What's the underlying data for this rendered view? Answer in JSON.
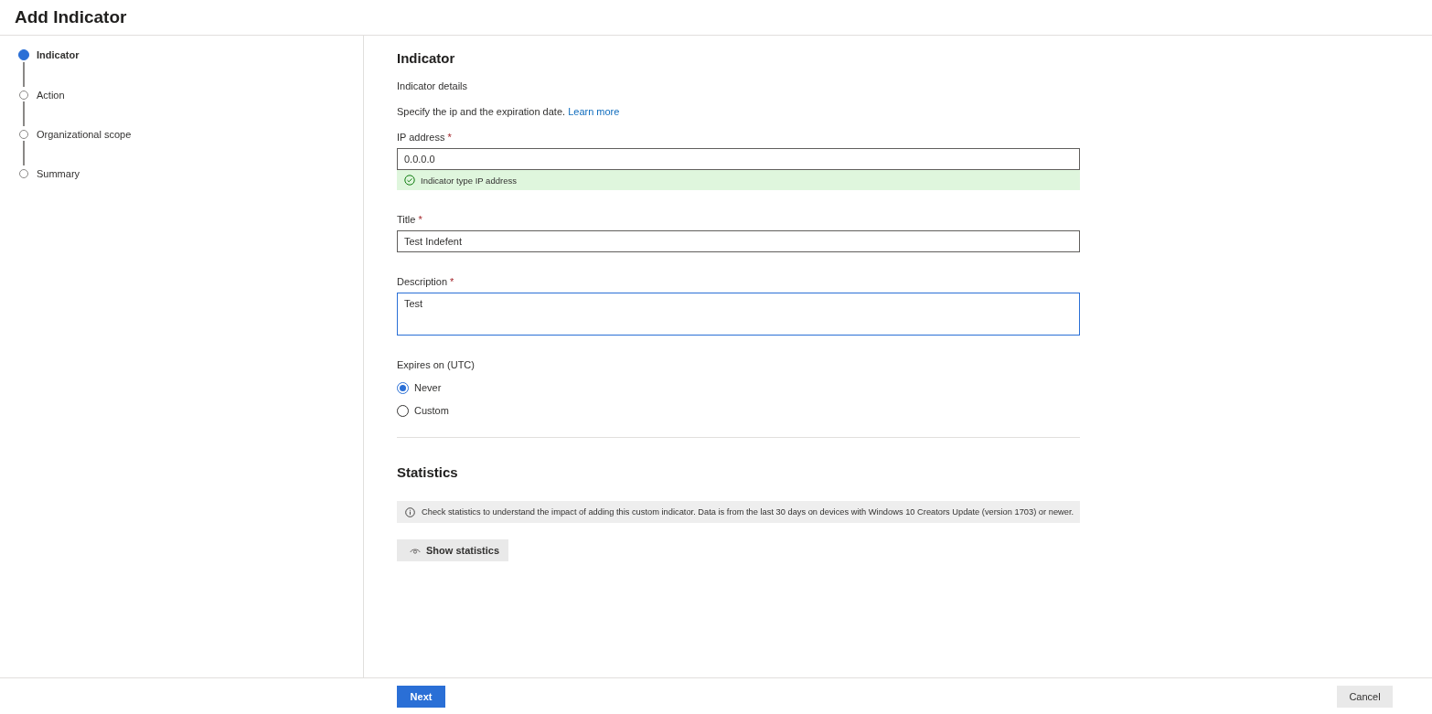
{
  "header": {
    "title": "Add Indicator"
  },
  "steps": [
    {
      "label": "Indicator",
      "selected": true
    },
    {
      "label": "Action",
      "selected": false
    },
    {
      "label": "Organizational scope",
      "selected": false
    },
    {
      "label": "Summary",
      "selected": false
    }
  ],
  "section": {
    "title": "Indicator",
    "subtitle": "Indicator details",
    "description": "Specify the ip and the expiration date.",
    "link": "Learn more"
  },
  "fields": [
    {
      "kind": "input",
      "label": "IP address",
      "required_mark": "*",
      "value": "0.0.0.0",
      "focused": false,
      "validation": "Indicator type IP address"
    },
    {
      "kind": "input",
      "label": "Title",
      "required_mark": "*",
      "value": "Test Indefent",
      "focused": false
    },
    {
      "kind": "textarea",
      "label": "Description",
      "required_mark": "*",
      "value": "Test",
      "focused": true
    }
  ],
  "expires": {
    "label": "Expires on (UTC)",
    "options": [
      {
        "label": "Never",
        "selected": true
      },
      {
        "label": "Custom",
        "selected": false
      }
    ]
  },
  "statistics": {
    "title": "Statistics",
    "info": "Check statistics to understand the impact of adding this custom indicator. Data is from the last 30 days on devices with Windows 10 Creators Update (version 1703) or newer.",
    "button": "Show statistics"
  },
  "footer": {
    "next": "Next",
    "cancel": "Cancel"
  }
}
